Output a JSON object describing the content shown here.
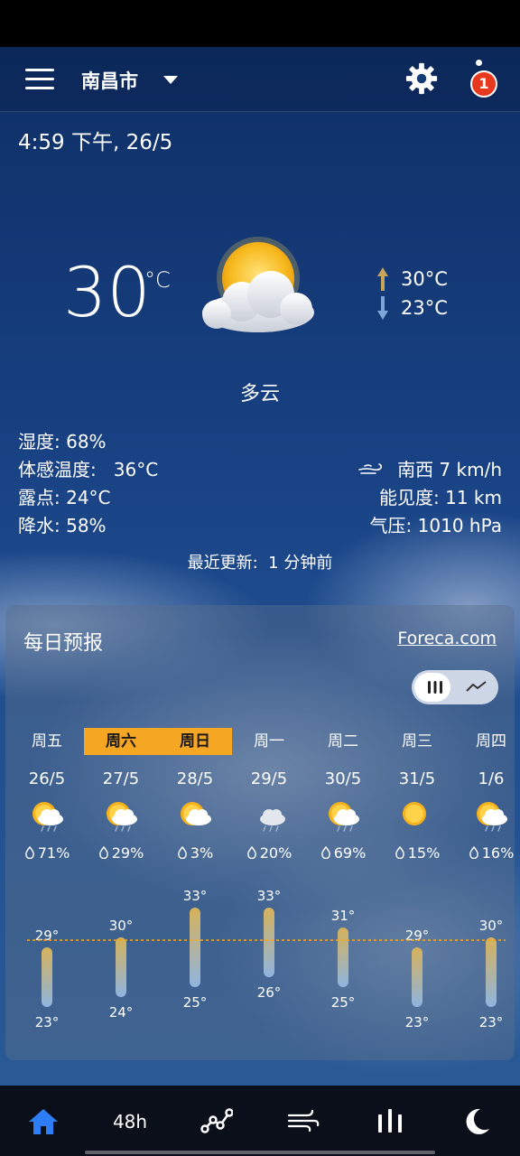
{
  "header": {
    "city": "南昌市",
    "alerts_count": "1"
  },
  "current": {
    "datetime": "4:59 下午, 26/5",
    "temperature": "30",
    "unit": "°C",
    "high": "30°C",
    "low": "23°C",
    "condition": "多云",
    "humidity": "湿度: 68%",
    "feels_like": "体感温度:   36°C",
    "dew_point": "露点: 24°C",
    "precipitation": "降水: 58%",
    "wind": "南西 7 km/h",
    "visibility": "能见度: 11 km",
    "pressure": "气压: 1010 hPa",
    "updated": "最近更新:  1 分钟前"
  },
  "daily": {
    "title": "每日预报",
    "source_link": "Foreca.com",
    "days": [
      {
        "name": "周五",
        "date": "26/5",
        "icon": "sun-cloud-rain-icon",
        "precip": "71%",
        "high": 29,
        "low": 23,
        "high_label": "29°",
        "low_label": "23°",
        "highlighted": false
      },
      {
        "name": "周六",
        "date": "27/5",
        "icon": "sun-cloud-rain-icon",
        "precip": "29%",
        "high": 30,
        "low": 24,
        "high_label": "30°",
        "low_label": "24°",
        "highlighted": true
      },
      {
        "name": "周日",
        "date": "28/5",
        "icon": "sun-cloud-icon",
        "precip": "3%",
        "high": 33,
        "low": 25,
        "high_label": "33°",
        "low_label": "25°",
        "highlighted": true
      },
      {
        "name": "周一",
        "date": "29/5",
        "icon": "cloud-rain-icon",
        "precip": "20%",
        "high": 33,
        "low": 26,
        "high_label": "33°",
        "low_label": "26°",
        "highlighted": false
      },
      {
        "name": "周二",
        "date": "30/5",
        "icon": "sun-cloud-rain-icon",
        "precip": "69%",
        "high": 31,
        "low": 25,
        "high_label": "31°",
        "low_label": "25°",
        "highlighted": false
      },
      {
        "name": "周三",
        "date": "31/5",
        "icon": "sun-icon",
        "precip": "15%",
        "high": 29,
        "low": 23,
        "high_label": "29°",
        "low_label": "23°",
        "highlighted": false
      },
      {
        "name": "周四",
        "date": "1/6",
        "icon": "sun-cloud-rain-icon",
        "precip": "16%",
        "high": 30,
        "low": 23,
        "high_label": "30°",
        "low_label": "23°",
        "highlighted": false
      }
    ],
    "current_temp_line": 30
  },
  "nav": {
    "hourly_label": "48h",
    "active_color": "#2f7df6"
  },
  "colors": {
    "highlight": "#f5a623",
    "alert": "#e8391e",
    "bar_top": "#d6b25a",
    "bar_bottom": "#8fb4e0"
  }
}
